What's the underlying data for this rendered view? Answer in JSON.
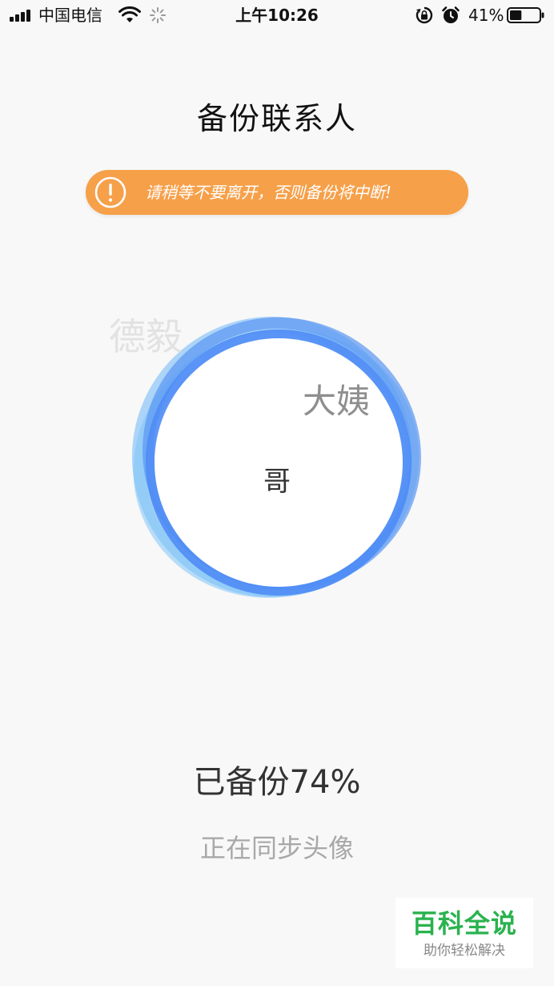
{
  "status_bar": {
    "carrier": "中国电信",
    "time": "上午10:26",
    "battery_percent": "41%",
    "battery_level": 0.41,
    "icons": [
      "signal-icon",
      "wifi-icon",
      "loading-spinner-icon",
      "rotation-lock-icon",
      "alarm-icon",
      "battery-icon"
    ]
  },
  "title": "备份联系人",
  "warning": {
    "icon": "exclamation-circle-icon",
    "text": "请稍等不要离开，否则备份将中断!"
  },
  "contact_names": {
    "faint": "德毅",
    "mid": "大姨",
    "center": "哥"
  },
  "progress": {
    "label": "已备份74%",
    "percent": 74,
    "status": "正在同步头像"
  },
  "watermark": {
    "title": "百科全说",
    "subtitle": "助你轻松解决"
  },
  "colors": {
    "background": "#f8f8f8",
    "warning_banner": "#f6a04a",
    "ring_blue": "#4f8cf5",
    "ring_light_blue": "#6bb6f7",
    "watermark_green": "#2ab24f"
  }
}
